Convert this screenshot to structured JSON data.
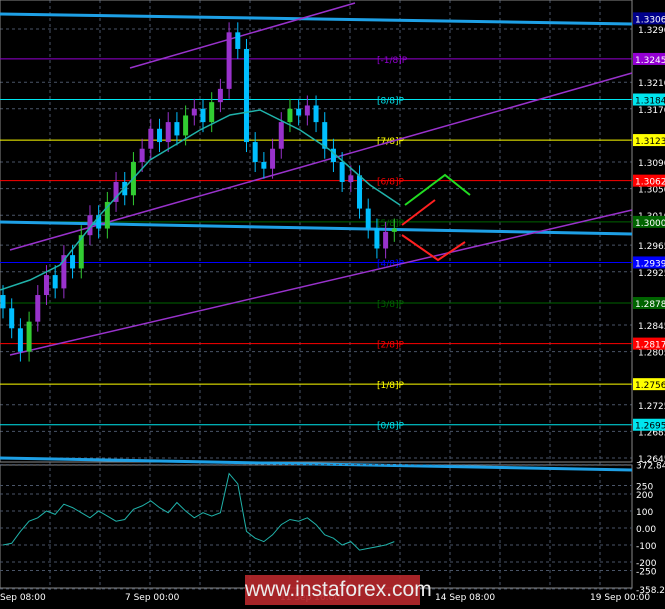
{
  "chart_data": {
    "type": "candlestick",
    "price_axis": {
      "ticks": [
        "1.3290",
        "1.3210",
        "1.3170",
        "1.3090",
        "1.3050",
        "1.3010",
        "1.2965",
        "1.2925",
        "1.2845",
        "1.2805",
        "1.2725",
        "1.2685",
        "1.2645"
      ],
      "range": [
        1.2635,
        1.3335
      ]
    },
    "time_axis": {
      "ticks": [
        "Sep 08:00",
        "7 Sep 00:00",
        "11 Sep 16:00",
        "14 Sep 08:00",
        "19 Sep 00:00"
      ]
    },
    "closes": [
      1.287,
      1.284,
      1.2805,
      1.285,
      1.289,
      1.292,
      1.29,
      1.295,
      1.293,
      1.298,
      1.301,
      1.299,
      1.303,
      1.306,
      1.304,
      1.309,
      1.311,
      1.314,
      1.312,
      1.315,
      1.313,
      1.316,
      1.317,
      1.315,
      1.318,
      1.32,
      1.3285,
      1.326,
      1.312,
      1.309,
      1.308,
      1.311,
      1.315,
      1.317,
      1.316,
      1.3175,
      1.315,
      1.311,
      1.309,
      1.306,
      1.307,
      1.302,
      1.299,
      1.296,
      1.2985,
      1.299
    ],
    "murrey_levels": [
      {
        "label": "[-1/8]P",
        "price": "1.3245",
        "color": "#9400d3"
      },
      {
        "label": "[8/8]P",
        "price": "1.3184",
        "color": "#00e5ee"
      },
      {
        "label": "[7/8]P",
        "price": "1.3123",
        "color": "#ffff00"
      },
      {
        "label": "[6/8]P",
        "price": "1.3062",
        "color": "#ff0000"
      },
      {
        "label": "[5/8]P",
        "price": "1.3000",
        "color": "#006400"
      },
      {
        "label": "[4/8]P",
        "price": "1.2939",
        "color": "#0000ff"
      },
      {
        "label": "[3/8]P",
        "price": "1.2878",
        "color": "#006400"
      },
      {
        "label": "[2/8]P",
        "price": "1.2817",
        "color": "#ff0000"
      },
      {
        "label": "[1/8]P",
        "price": "1.2756",
        "color": "#ffff00"
      },
      {
        "label": "[0/8]P",
        "price": "1.2695",
        "color": "#00e5ee"
      }
    ],
    "top_badge": {
      "price": "1.3306",
      "color": "#00008b"
    },
    "oscillator": {
      "ticks": [
        "372.8496",
        "250",
        "200",
        "100",
        "0.00",
        "-100",
        "-200",
        "-250",
        "-358.25"
      ],
      "values": [
        -100,
        -90,
        -20,
        40,
        60,
        100,
        80,
        140,
        120,
        90,
        60,
        100,
        70,
        40,
        50,
        110,
        130,
        160,
        120,
        90,
        150,
        100,
        60,
        90,
        70,
        90,
        320,
        260,
        -20,
        -60,
        -80,
        -40,
        20,
        50,
        40,
        60,
        20,
        -40,
        -60,
        -100,
        -80,
        -130,
        -120,
        -110,
        -100,
        -80
      ]
    }
  },
  "watermark": "www.instaforex.com"
}
